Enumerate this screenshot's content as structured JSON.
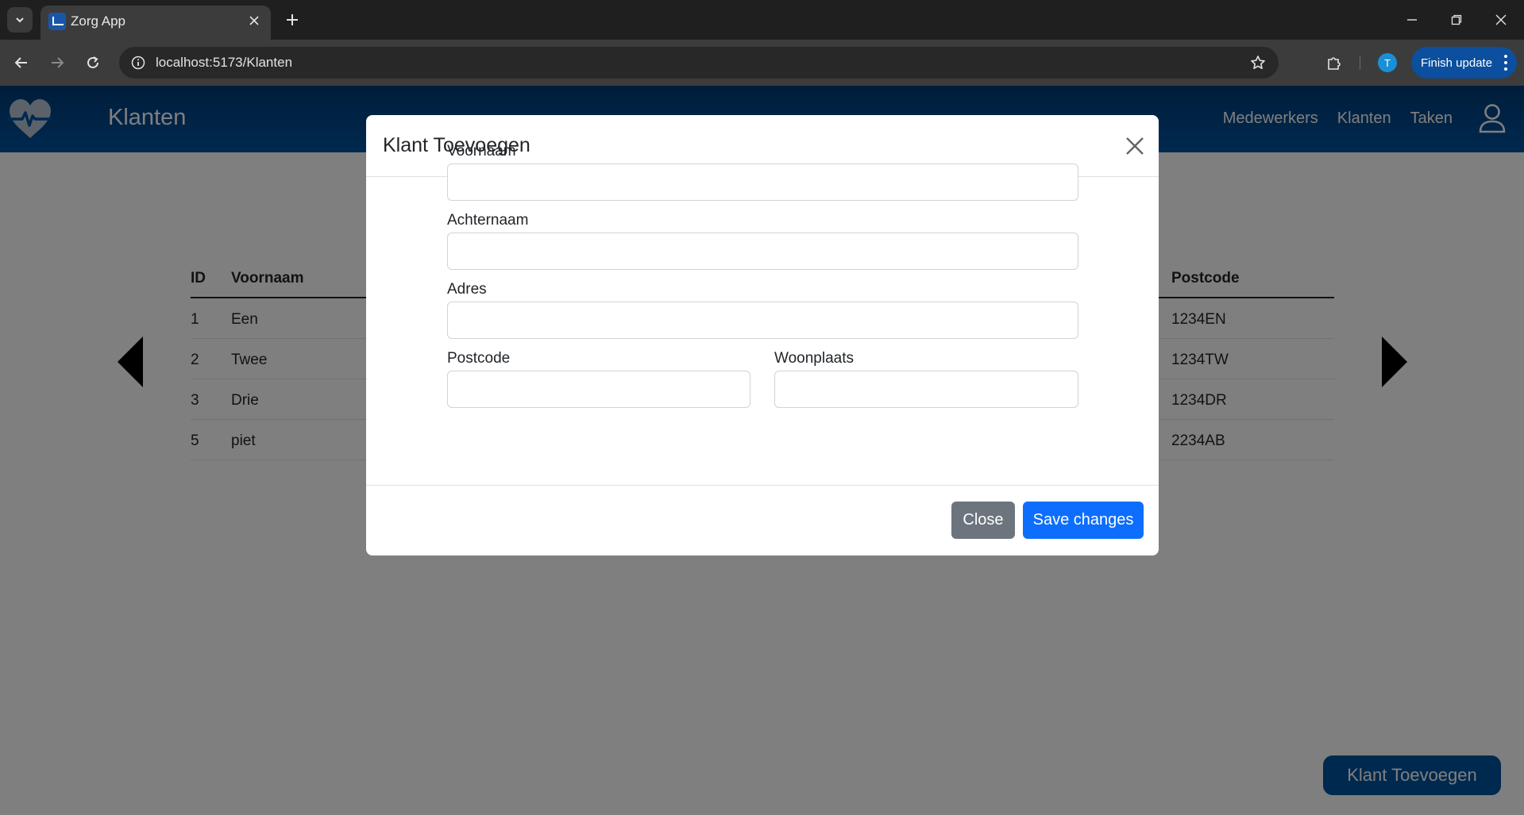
{
  "browser": {
    "tab_title": "Zorg App",
    "url": "localhost:5173/Klanten",
    "profile_initial": "T",
    "finish_update_label": "Finish update"
  },
  "app": {
    "page_title": "Klanten",
    "nav": [
      "Medewerkers",
      "Klanten",
      "Taken"
    ],
    "table": {
      "headers": {
        "id": "ID",
        "voornaam": "Voornaam",
        "postcode": "Postcode"
      },
      "rows": [
        {
          "id": "1",
          "voornaam": "Een",
          "postcode": "1234EN"
        },
        {
          "id": "2",
          "voornaam": "Twee",
          "postcode": "1234TW"
        },
        {
          "id": "3",
          "voornaam": "Drie",
          "postcode": "1234DR"
        },
        {
          "id": "5",
          "voornaam": "piet",
          "postcode": "2234AB"
        }
      ]
    },
    "add_button_label": "Klant Toevoegen"
  },
  "modal": {
    "title": "Klant Toevoegen",
    "fields": {
      "voornaam": {
        "label": "Voornaam",
        "value": ""
      },
      "achternaam": {
        "label": "Achternaam",
        "value": ""
      },
      "adres": {
        "label": "Adres",
        "value": ""
      },
      "postcode": {
        "label": "Postcode",
        "value": ""
      },
      "woonplaats": {
        "label": "Woonplaats",
        "value": ""
      }
    },
    "close_label": "Close",
    "save_label": "Save changes"
  },
  "colors": {
    "header": "#00539f",
    "primary": "#0d6efd",
    "secondary": "#6c757d"
  },
  "icons": {
    "logo": "heart-pulse-icon",
    "user": "user-icon",
    "prev": "triangle-left-icon",
    "next": "triangle-right-icon",
    "close": "close-icon"
  }
}
